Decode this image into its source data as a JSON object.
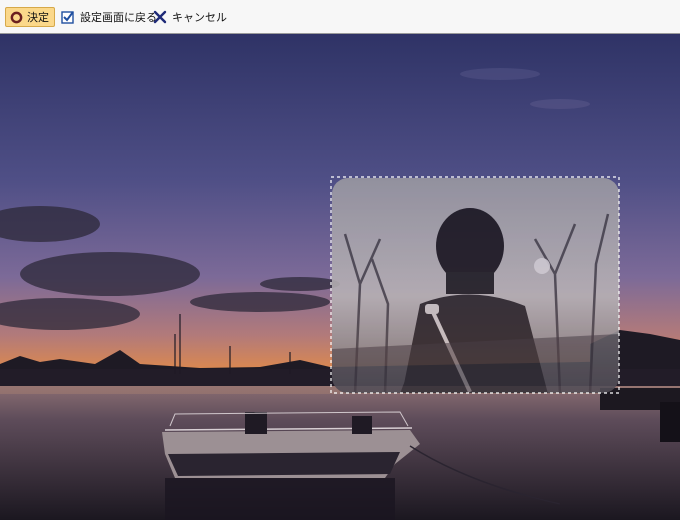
{
  "toolbar": {
    "ok_label": "決定",
    "back_label": "設定画面に戻る",
    "cancel_label": "キャンセル"
  },
  "colors": {
    "ok_button_bg": "#fbd88a",
    "ok_icon": "#6b1f1f",
    "back_icon": "#1f4fa0",
    "cancel_icon": "#1e2a78"
  }
}
